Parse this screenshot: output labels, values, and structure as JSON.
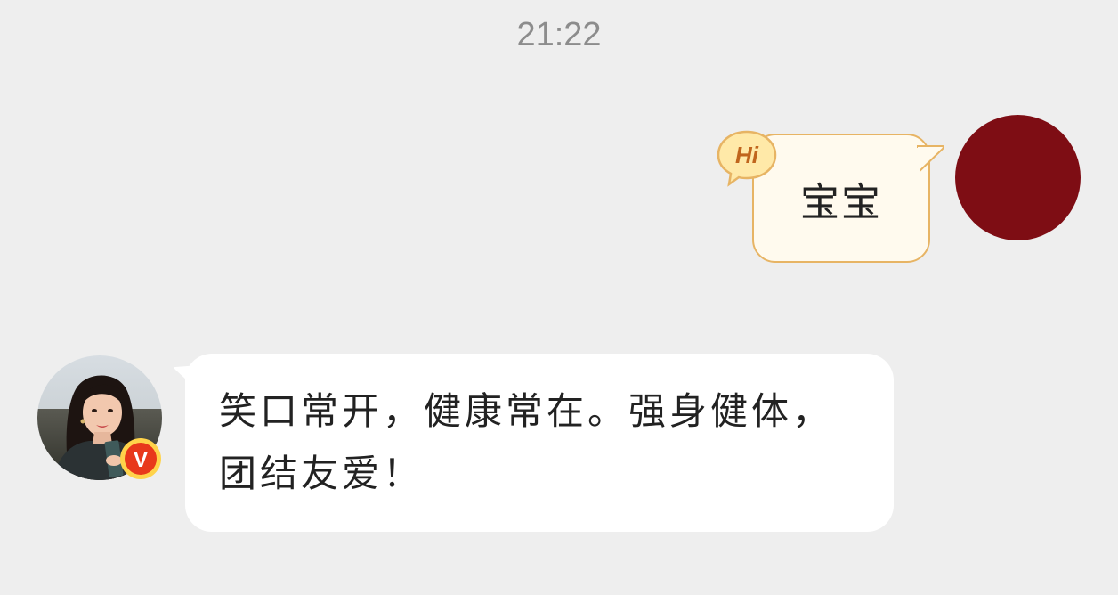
{
  "chat": {
    "timestamp": "21:22",
    "messages": [
      {
        "direction": "outgoing",
        "sender": "self",
        "text": "宝宝",
        "badge": "Hi",
        "bubble_color": "#fffaee",
        "bubble_border_color": "#e7b464",
        "avatar_color": "#7e0d14"
      },
      {
        "direction": "incoming",
        "sender": "other",
        "text": "笑口常开，健康常在。强身健体，团结友爱！",
        "verified_mark": "V",
        "verified_badge_color": "#e8381b",
        "bubble_color": "#ffffff"
      }
    ]
  }
}
